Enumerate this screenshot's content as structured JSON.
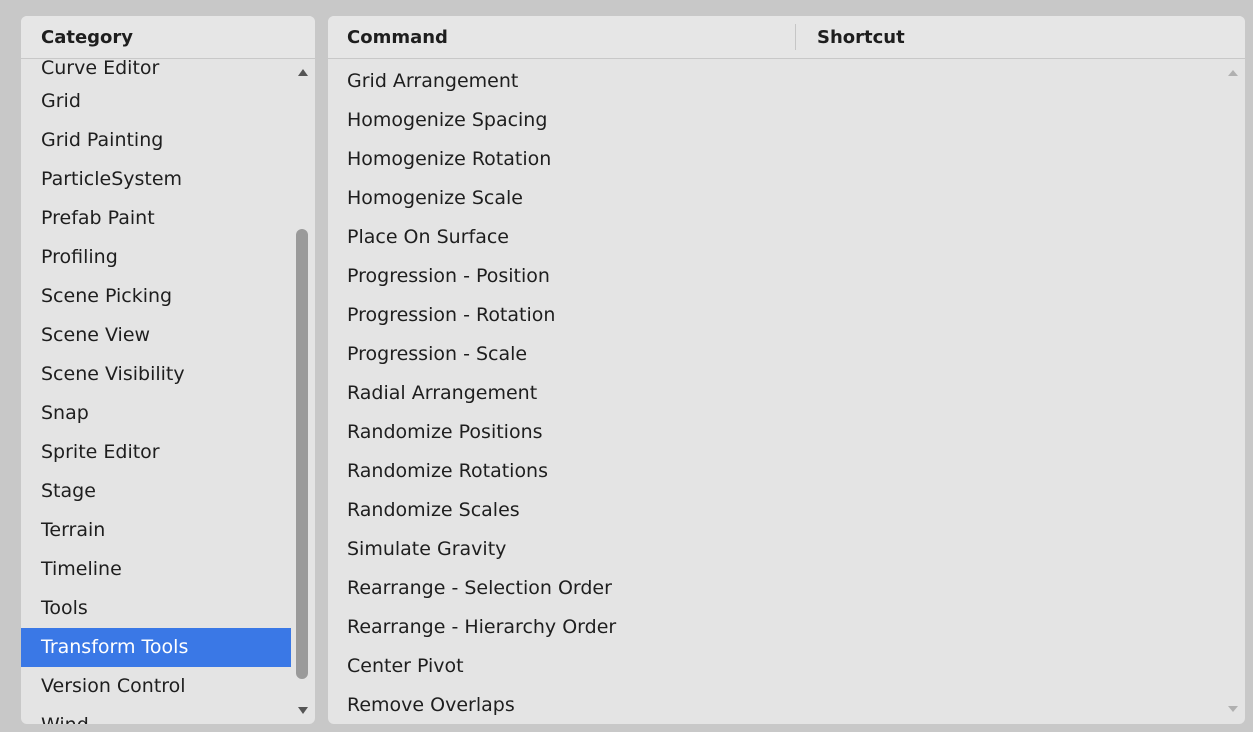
{
  "category_panel": {
    "header": "Category",
    "items": [
      "Curve Editor",
      "Grid",
      "Grid Painting",
      "ParticleSystem",
      "Prefab Paint",
      "Profiling",
      "Scene Picking",
      "Scene View",
      "Scene Visibility",
      "Snap",
      "Sprite Editor",
      "Stage",
      "Terrain",
      "Timeline",
      "Tools",
      "Transform Tools",
      "Version Control",
      "Wind..."
    ],
    "selected": "Transform Tools"
  },
  "command_panel": {
    "header_command": "Command",
    "header_shortcut": "Shortcut",
    "commands": [
      "Grid Arrangement",
      "Homogenize Spacing",
      "Homogenize Rotation",
      "Homogenize Scale",
      "Place On Surface",
      "Progression - Position",
      "Progression - Rotation",
      "Progression - Scale",
      "Radial Arrangement",
      "Randomize Positions",
      "Randomize Rotations",
      "Randomize Scales",
      "Simulate Gravity",
      "Rearrange - Selection Order",
      "Rearrange - Hierarchy Order",
      "Center Pivot",
      "Remove Overlaps"
    ]
  },
  "colors": {
    "selection": "#3a78e6",
    "panel_bg": "#e4e4e4",
    "window_bg": "#c8c8c8"
  },
  "icons": [
    "scroll-up-arrow-icon",
    "scroll-down-arrow-icon"
  ]
}
